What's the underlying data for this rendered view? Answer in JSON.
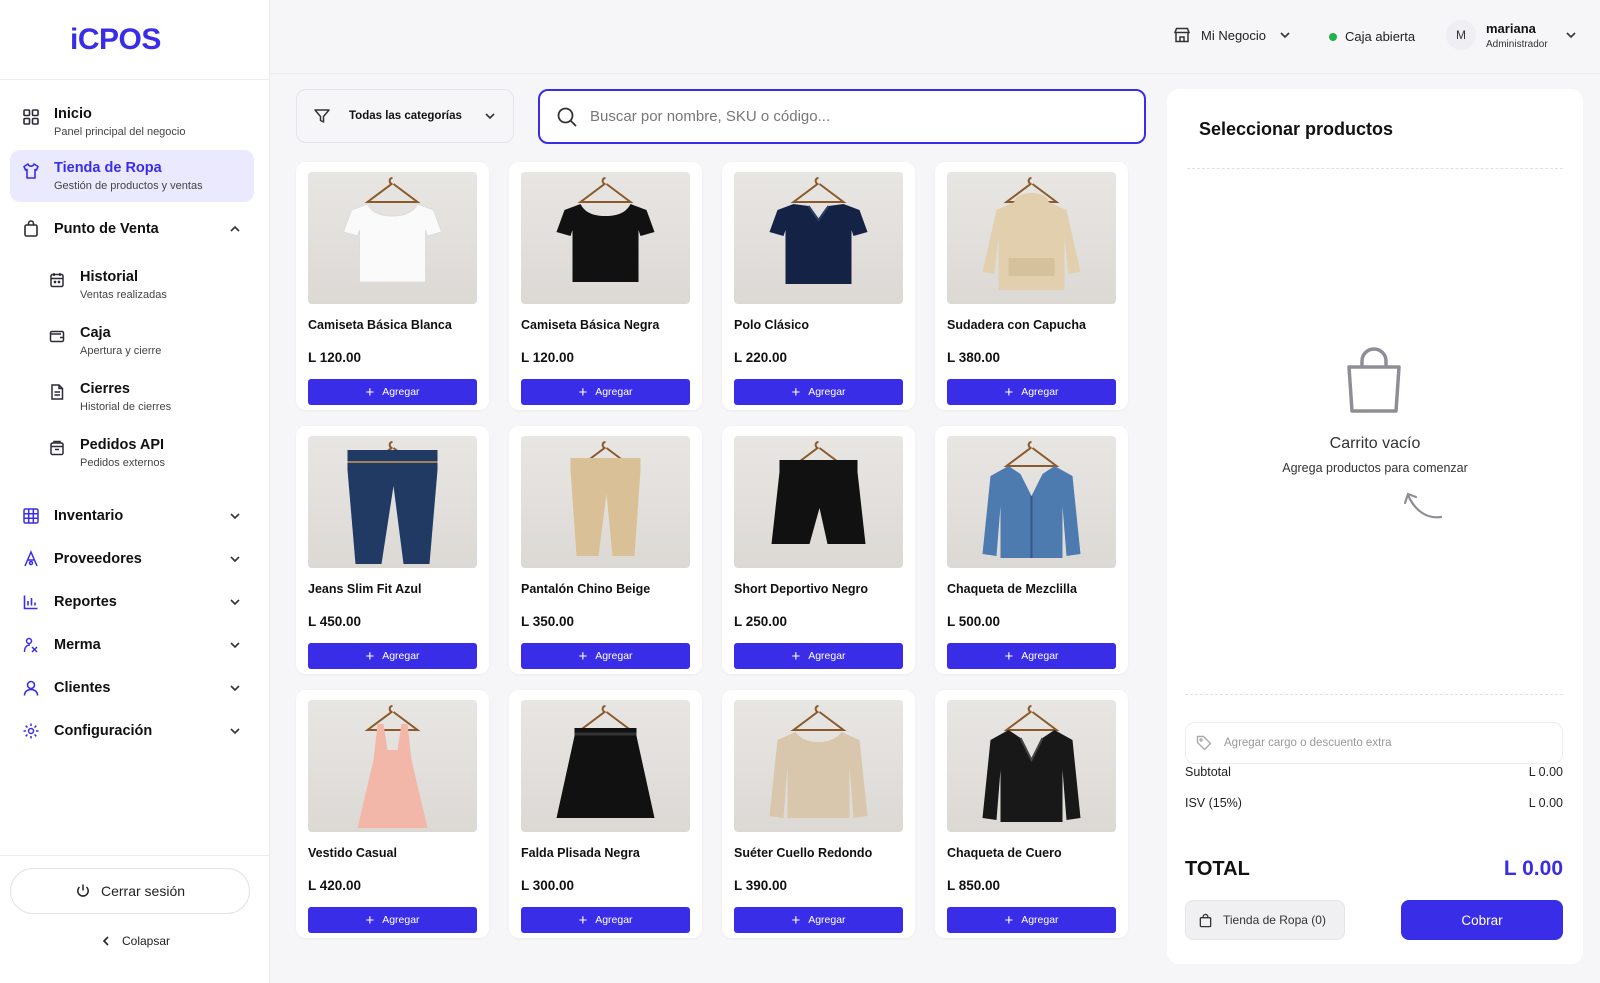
{
  "brand": {
    "logo": "iCPOS"
  },
  "sidebar": {
    "inicio": {
      "title": "Inicio",
      "sub": "Panel principal del negocio"
    },
    "tienda": {
      "title": "Tienda de Ropa",
      "sub": "Gestión de productos y ventas"
    },
    "pos": {
      "title": "Punto de Venta",
      "items": [
        {
          "title": "Historial",
          "sub": "Ventas realizadas"
        },
        {
          "title": "Caja",
          "sub": "Apertura y cierre"
        },
        {
          "title": "Cierres",
          "sub": "Historial de cierres"
        },
        {
          "title": "Pedidos API",
          "sub": "Pedidos externos"
        }
      ]
    },
    "groups": [
      {
        "title": "Inventario"
      },
      {
        "title": "Proveedores"
      },
      {
        "title": "Reportes"
      },
      {
        "title": "Merma"
      },
      {
        "title": "Clientes"
      },
      {
        "title": "Configuración"
      }
    ],
    "logout": "Cerrar sesión",
    "collapse": "Colapsar"
  },
  "header": {
    "business": "Mi Negocio",
    "register_status": "Caja abierta",
    "user": {
      "initial": "M",
      "name": "mariana",
      "role": "Administrador"
    }
  },
  "filters": {
    "category": "Todas las categorías",
    "search_placeholder": "Buscar por nombre, SKU o código..."
  },
  "add_label": "Agregar",
  "products": [
    {
      "name": "Camiseta Básica Blanca",
      "price": "L 120.00",
      "image": "white-tshirt"
    },
    {
      "name": "Camiseta Básica Negra",
      "price": "L 120.00",
      "image": "black-tshirt"
    },
    {
      "name": "Polo Clásico",
      "price": "L 220.00",
      "image": "navy-polo"
    },
    {
      "name": "Sudadera con Capucha",
      "price": "L 380.00",
      "image": "beige-hoodie"
    },
    {
      "name": "Jeans Slim Fit Azul",
      "price": "L 450.00",
      "image": "blue-jeans"
    },
    {
      "name": "Pantalón Chino Beige",
      "price": "L 350.00",
      "image": "beige-chinos"
    },
    {
      "name": "Short Deportivo Negro",
      "price": "L 250.00",
      "image": "black-shorts"
    },
    {
      "name": "Chaqueta de Mezclilla",
      "price": "L 500.00",
      "image": "denim-jacket"
    },
    {
      "name": "Vestido Casual",
      "price": "L 420.00",
      "image": "pink-dress"
    },
    {
      "name": "Falda Plisada Negra",
      "price": "L 300.00",
      "image": "black-skirt"
    },
    {
      "name": "Suéter Cuello Redondo",
      "price": "L 390.00",
      "image": "beige-sweater"
    },
    {
      "name": "Chaqueta de Cuero",
      "price": "L 850.00",
      "image": "leather-jacket"
    }
  ],
  "cart": {
    "title": "Seleccionar productos",
    "empty_title": "Carrito vacío",
    "empty_sub": "Agrega productos para comenzar",
    "extra_placeholder": "Agregar cargo o descuento extra",
    "subtotal_label": "Subtotal",
    "subtotal_value": "L 0.00",
    "tax_label": "ISV (15%)",
    "tax_value": "L 0.00",
    "total_label": "TOTAL",
    "total_value": "L 0.00",
    "store_chip": "Tienda de Ropa (0)",
    "checkout": "Cobrar"
  },
  "colors": {
    "accent": "#3a2de8",
    "active_bg": "#ebe9fd",
    "status_green": "#22b14c"
  }
}
